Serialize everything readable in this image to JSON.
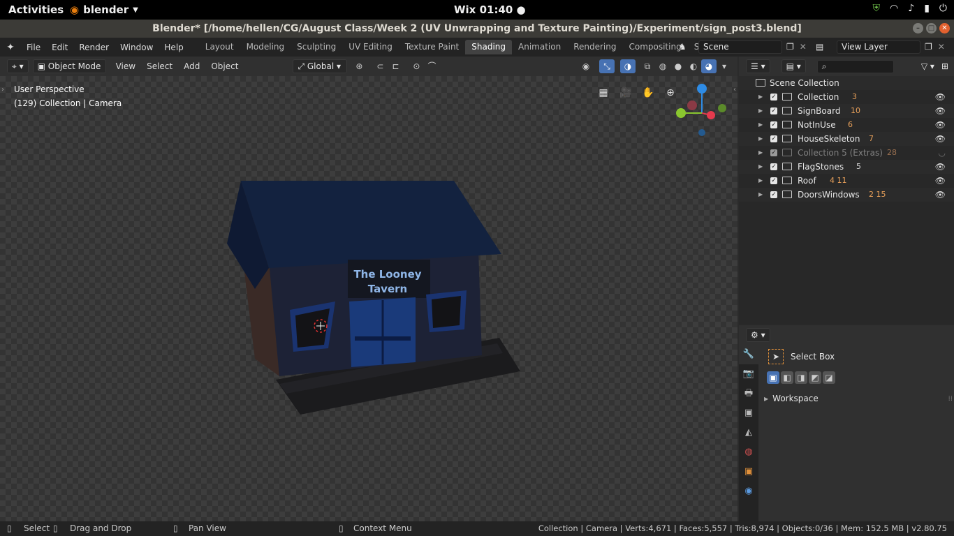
{
  "system_bar": {
    "activities": "Activities",
    "app_name": "blender",
    "clock": "Wix 01:40 ●"
  },
  "window": {
    "title": "Blender* [/home/hellen/CG/August Class/Week 2 (UV Unwrapping and Texture Painting)/Experiment/sign_post3.blend]"
  },
  "menu": {
    "items": [
      "File",
      "Edit",
      "Render",
      "Window",
      "Help"
    ]
  },
  "workspaces": {
    "tabs": [
      "Layout",
      "Modeling",
      "Sculpting",
      "UV Editing",
      "Texture Paint",
      "Shading",
      "Animation",
      "Rendering",
      "Compositing",
      "Scripting"
    ],
    "active": "Shading",
    "add": "+"
  },
  "scene": {
    "name": "Scene"
  },
  "view_layer": {
    "name": "View Layer"
  },
  "viewport_header": {
    "mode": "Object Mode",
    "menus": [
      "View",
      "Select",
      "Add",
      "Object"
    ],
    "transform_orientation": "Global"
  },
  "viewport": {
    "perspective": "User Perspective",
    "context": "(129) Collection | Camera",
    "sign_line1": "The Looney",
    "sign_line2": "Tavern"
  },
  "outliner": {
    "root": "Scene Collection",
    "rows": [
      {
        "name": "Collection",
        "badges": "3"
      },
      {
        "name": "SignBoard",
        "badges": "10"
      },
      {
        "name": "NotInUse",
        "badges": "6"
      },
      {
        "name": "HouseSkeleton",
        "badges": "7"
      },
      {
        "name": "Collection 5 (Extras)",
        "badges": "28"
      },
      {
        "name": "FlagStones",
        "badges": "5"
      },
      {
        "name": "Roof",
        "badges": "4 11"
      },
      {
        "name": "DoorsWindows",
        "badges": "2 15"
      }
    ]
  },
  "properties": {
    "tool": "Select Box",
    "panel": "Workspace"
  },
  "status": {
    "select": "Select",
    "drag": "Drag and Drop",
    "pan": "Pan View",
    "context": "Context Menu",
    "info": "Collection | Camera | Verts:4,671 | Faces:5,557 | Tris:8,974 | Objects:0/36 | Mem: 152.5 MB | v2.80.75"
  },
  "colors": {
    "accent": "#4772b3",
    "active_tab": "#424242",
    "gizmo_x": "#e53a4d",
    "gizmo_y": "#8ac72f",
    "gizmo_z": "#2e8ce6"
  }
}
